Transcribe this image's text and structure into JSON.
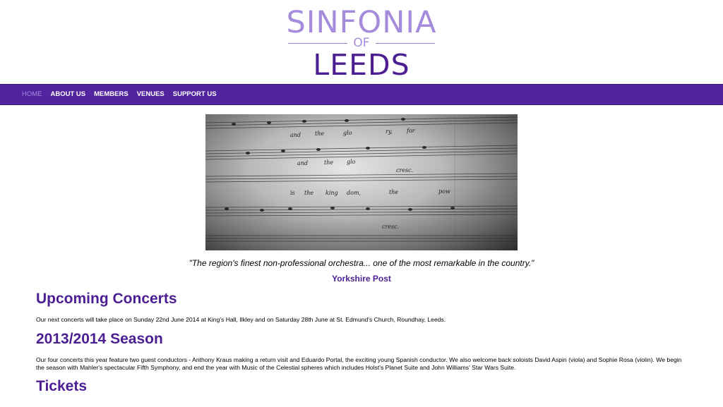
{
  "header": {
    "logo_line1": "SINFONIA",
    "logo_of": "OF",
    "logo_line2": "LEEDS"
  },
  "nav": {
    "items": [
      {
        "label": "HOME",
        "active": true
      },
      {
        "label": "ABOUT US",
        "active": false
      },
      {
        "label": "MEMBERS",
        "active": false
      },
      {
        "label": "VENUES",
        "active": false
      },
      {
        "label": "SUPPORT US",
        "active": false
      }
    ]
  },
  "hero": {
    "image_icon": "sheet-music-photo",
    "lyrics": [
      "and",
      "the",
      "glo",
      "ry,",
      "for",
      "and",
      "the",
      "glo",
      "cresc.",
      "is",
      "the",
      "king",
      "dom,",
      "the",
      "pow",
      "cresc."
    ]
  },
  "quote": {
    "text": "\"The region's finest non-professional orchestra... one of the most remarkable in the country.\"",
    "source": "Yorkshire Post"
  },
  "sections": [
    {
      "heading": "Upcoming Concerts",
      "body": "Our next concerts will take place on Sunday 22nd June 2014 at King's Hall, Ilkley and on Saturday 28th June at St. Edmund's Church, Roundhay, Leeds."
    },
    {
      "heading": "2013/2014 Season",
      "body": "Our four concerts this year feature two guest conductors - Anthony Kraus making a return visit and Eduardo Portal, the exciting young Spanish conductor. We also welcome back soloists David Aspin (viola) and Sophie Rosa (violin). We begin the season with Mahler's spectacular Fifth Symphony, and end the year with Music of the Celestial spheres which includes Holst's Planet Suite and John Williams' Star Wars Suite."
    },
    {
      "heading": "Tickets",
      "body": ""
    }
  ],
  "colors": {
    "brand_purple": "#52259f",
    "heading_purple": "#4b1f92",
    "logo_light": "#a48bdc"
  }
}
